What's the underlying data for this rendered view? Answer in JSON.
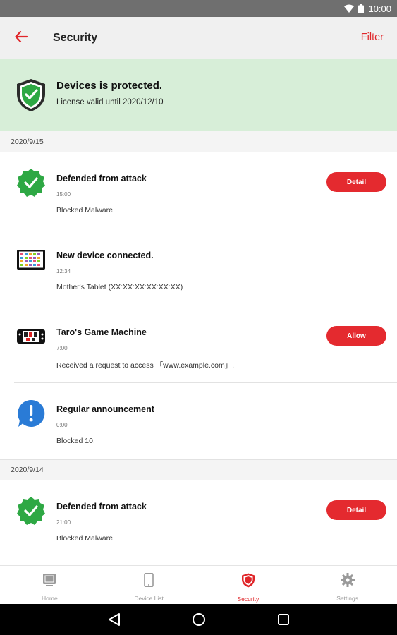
{
  "status_bar": {
    "time": "10:00",
    "icons": [
      "wifi-icon",
      "battery-icon"
    ]
  },
  "app_bar": {
    "title": "Security",
    "filter_label": "Filter",
    "back_icon": "arrow-left-icon"
  },
  "banner": {
    "title": "Devices is protected.",
    "subtitle": "License valid until 2020/12/10",
    "icon": "shield-check-icon"
  },
  "groups": [
    {
      "date": "2020/9/15",
      "items": [
        {
          "icon": "check-badge-icon",
          "title": "Defended from attack",
          "time": "15:00",
          "description": "Blocked Malware.",
          "action": "Detail"
        },
        {
          "icon": "tablet-icon",
          "title": "New device connected.",
          "time": "12:34",
          "description": "Mother's Tablet (XX:XX:XX:XX:XX:XX)",
          "action": ""
        },
        {
          "icon": "game-machine-icon",
          "title": "Taro's Game Machine",
          "time": "7:00",
          "description": "Received a request to access 「www.example.com」.",
          "action": "Allow"
        },
        {
          "icon": "announcement-icon",
          "title": "Regular announcement",
          "time": "0:00",
          "description": "Blocked 10.",
          "action": ""
        }
      ]
    },
    {
      "date": "2020/9/14",
      "items": [
        {
          "icon": "check-badge-icon",
          "title": "Defended from attack",
          "time": "21:00",
          "description": "Blocked Malware.",
          "action": "Detail"
        }
      ]
    }
  ],
  "bottom_nav": [
    {
      "label": "Home",
      "icon": "home-icon",
      "active": false
    },
    {
      "label": "Device List",
      "icon": "phone-icon",
      "active": false
    },
    {
      "label": "Security",
      "icon": "shield-icon",
      "active": true
    },
    {
      "label": "Settings",
      "icon": "gear-icon",
      "active": false
    }
  ],
  "system_nav": [
    "back-triangle-icon",
    "home-circle-icon",
    "recents-square-icon"
  ],
  "colors": {
    "accent": "#e0262a",
    "banner_bg": "#d7eed8",
    "success": "#2ea844",
    "info": "#2a7bd6"
  }
}
